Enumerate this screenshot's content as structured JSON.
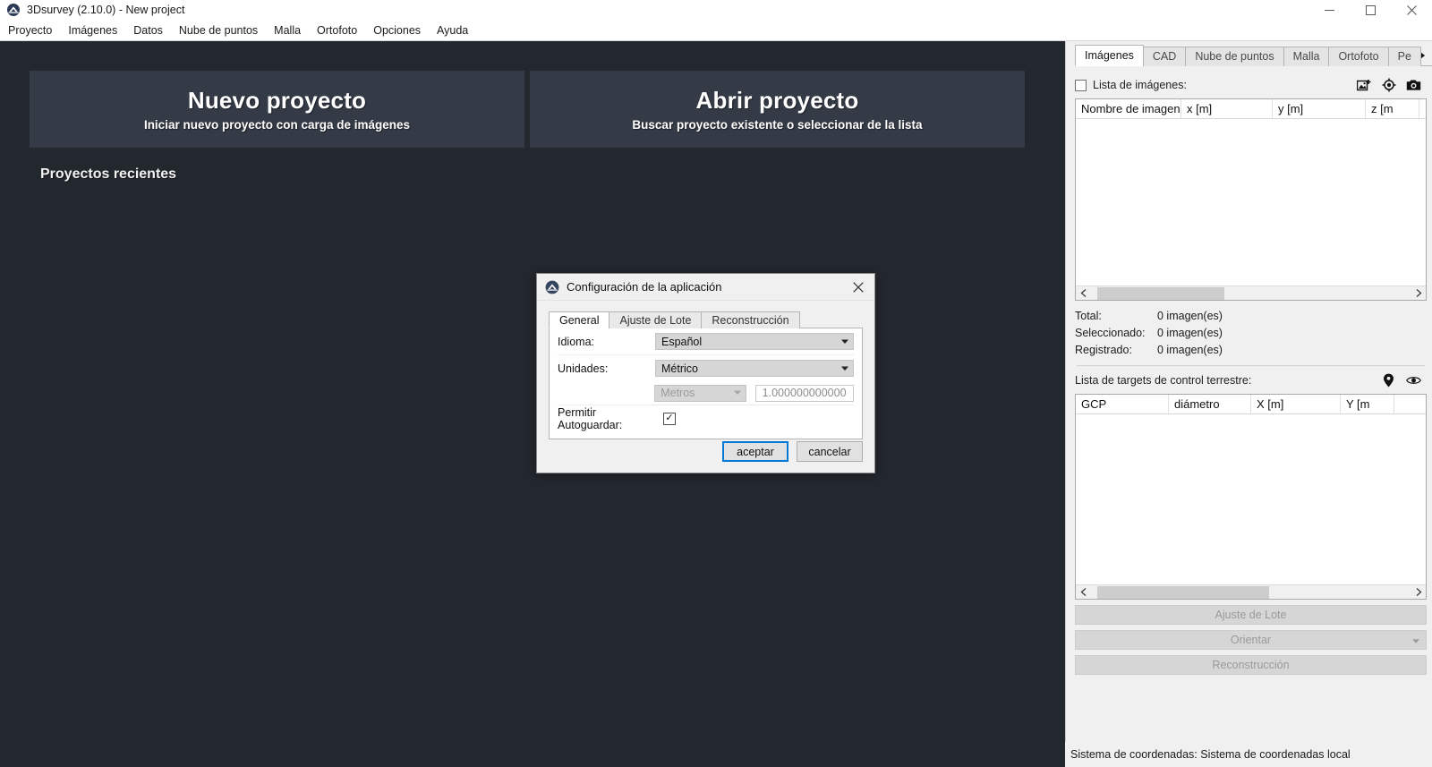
{
  "window": {
    "title": "3Dsurvey (2.10.0) - New project",
    "app_icon": "3dsurvey-logo-icon",
    "controls": {
      "minimize": "—",
      "maximize": "❐",
      "close": "✕"
    }
  },
  "menubar": {
    "items": [
      {
        "label": "Proyecto"
      },
      {
        "label": "Imágenes"
      },
      {
        "label": "Datos"
      },
      {
        "label": "Nube de puntos"
      },
      {
        "label": "Malla"
      },
      {
        "label": "Ortofoto"
      },
      {
        "label": "Opciones"
      },
      {
        "label": "Ayuda"
      }
    ]
  },
  "workspace": {
    "tiles": [
      {
        "title": "Nuevo proyecto",
        "subtitle": "Iniciar nuevo proyecto con carga de imágenes"
      },
      {
        "title": "Abrir proyecto",
        "subtitle": "Buscar proyecto existente o seleccionar de la lista"
      }
    ],
    "recent_title": "Proyectos recientes"
  },
  "right_panel": {
    "tabs": [
      {
        "label": "Imágenes",
        "active": true
      },
      {
        "label": "CAD",
        "active": false
      },
      {
        "label": "Nube de puntos",
        "active": false
      },
      {
        "label": "Malla",
        "active": false
      },
      {
        "label": "Ortofoto",
        "active": false
      },
      {
        "label": "Pe",
        "active": false
      }
    ],
    "tab_scroll_icon": "chevron-right-icon",
    "images_section": {
      "checkbox_label": "Lista de imágenes:",
      "checked": false,
      "icons": [
        "add-image-icon",
        "target-icon",
        "camera-icon"
      ],
      "columns": [
        "Nombre de imagen",
        "x [m]",
        "y [m]",
        "z [m"
      ],
      "rows": []
    },
    "stats": [
      {
        "label": "Total:",
        "value": "0 imagen(es)"
      },
      {
        "label": "Seleccionado:",
        "value": "0 imagen(es)"
      },
      {
        "label": "Registrado:",
        "value": "0 imagen(es)"
      }
    ],
    "gcp_section": {
      "label": "Lista de targets de control terrestre:",
      "icons": [
        "map-pin-icon",
        "eye-icon"
      ],
      "columns": [
        "GCP",
        "diámetro",
        "X [m]",
        "Y [m"
      ],
      "rows": []
    },
    "action_buttons": [
      {
        "label": "Ajuste de Lote",
        "has_caret": false
      },
      {
        "label": "Orientar",
        "has_caret": true
      },
      {
        "label": "Reconstrucción",
        "has_caret": false
      }
    ],
    "scroll_left_icon": "chevron-left-icon",
    "scroll_right_icon": "chevron-right-icon"
  },
  "statusbar": {
    "text": "Sistema de coordenadas: Sistema de coordenadas local"
  },
  "dialog": {
    "icon": "3dsurvey-logo-icon",
    "title": "Configuración de la aplicación",
    "close_icon": "close-icon",
    "tabs": [
      {
        "label": "General",
        "active": true
      },
      {
        "label": "Ajuste de Lote",
        "active": false
      },
      {
        "label": "Reconstrucción",
        "active": false
      }
    ],
    "fields": {
      "language_label": "Idioma:",
      "language_value": "Español",
      "units_label": "Unidades:",
      "units_value": "Métrico",
      "unit_sub_value": "Metros",
      "unit_factor_value": "1.000000000000",
      "autosave_label": "Permitir Autoguardar:",
      "autosave_checked": true,
      "check_glyph": "✓"
    },
    "buttons": {
      "accept": "aceptar",
      "cancel": "cancelar"
    }
  },
  "colors": {
    "workspace_bg": "#23272e",
    "tile_bg": "#343b47",
    "accent": "#0078d7",
    "panel_bg": "#f0f0f0"
  }
}
